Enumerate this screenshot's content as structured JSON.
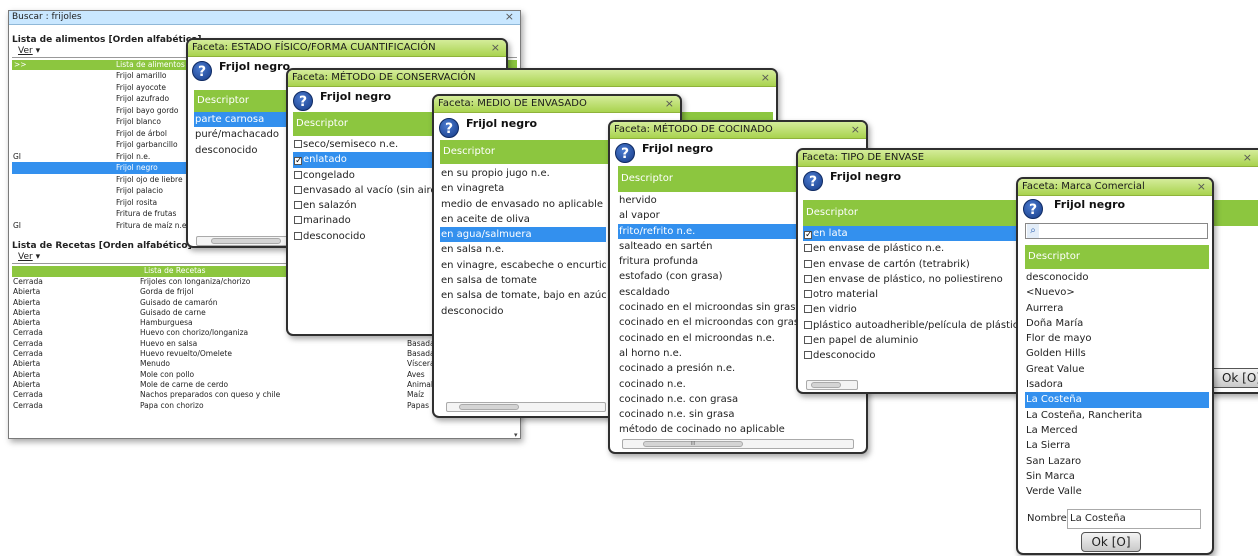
{
  "search_window": {
    "title": "Buscar : frijoles",
    "foods_title": "Lista de alimentos [Orden alfabético]",
    "recipes_title": "Lista de Recetas [Orden alfabético]",
    "ver_label": "Ver",
    "foods_header_left": ">>",
    "foods_header": "Lista de alimentos",
    "foods": [
      {
        "code": "",
        "name": "Frijol amarillo"
      },
      {
        "code": "",
        "name": "Frijol ayocote"
      },
      {
        "code": "",
        "name": "Frijol azufrado"
      },
      {
        "code": "",
        "name": "Frijol bayo gordo"
      },
      {
        "code": "",
        "name": "Frijol blanco"
      },
      {
        "code": "",
        "name": "Frijol de árbol"
      },
      {
        "code": "",
        "name": "Frijol garbancillo"
      },
      {
        "code": "GI",
        "name": "Frijol n.e."
      },
      {
        "code": "",
        "name": "Frijol negro"
      },
      {
        "code": "",
        "name": "Frijol ojo de liebre"
      },
      {
        "code": "",
        "name": "Frijol palacio"
      },
      {
        "code": "",
        "name": "Frijol rosita"
      },
      {
        "code": "",
        "name": "Fritura de frutas"
      },
      {
        "code": "GI",
        "name": "Fritura de maíz n.e."
      }
    ],
    "recipes_header": "Lista de Recetas",
    "recipes": [
      {
        "status": "Cerrada",
        "name": "Frijoles con longaniza/chorizo",
        "cat": ""
      },
      {
        "status": "Abierta",
        "name": "Gorda de frijol",
        "cat": ""
      },
      {
        "status": "Abierta",
        "name": "Guisado de camarón",
        "cat": ""
      },
      {
        "status": "Abierta",
        "name": "Guisado de carne",
        "cat": ""
      },
      {
        "status": "Abierta",
        "name": "Hamburguesa",
        "cat": ""
      },
      {
        "status": "Cerrada",
        "name": "Huevo con chorizo/longaniza",
        "cat": "Basada"
      },
      {
        "status": "Cerrada",
        "name": "Huevo en salsa",
        "cat": "Basada"
      },
      {
        "status": "Cerrada",
        "name": "Huevo revuelto/Omelete",
        "cat": "Basada"
      },
      {
        "status": "Abierta",
        "name": "Menudo",
        "cat": "Vísceras"
      },
      {
        "status": "Abierta",
        "name": "Mole con pollo",
        "cat": "Aves"
      },
      {
        "status": "Abierta",
        "name": "Mole de carne de cerdo",
        "cat": "Animal"
      },
      {
        "status": "Cerrada",
        "name": "Nachos preparados con queso y chile",
        "cat": "Maíz"
      },
      {
        "status": "Cerrada",
        "name": "Papa con chorizo",
        "cat": "Papas"
      }
    ]
  },
  "facet1": {
    "title": "Faceta: ESTADO FÍSICO/FORMA CUANTIFICACIÓN",
    "food": "Frijol negro",
    "header": "Descriptor",
    "items": [
      "parte carnosa",
      "puré/machacado",
      "desconocido"
    ],
    "selected": 0
  },
  "facet2": {
    "title": "Faceta: MÉTODO DE CONSERVACIÓN",
    "food": "Frijol negro",
    "header": "Descriptor",
    "items": [
      "seco/semiseco n.e.",
      "enlatado",
      "congelado",
      "envasado al vacío (sin aire)",
      "en salazón",
      "marinado",
      "desconocido"
    ],
    "selected": 1
  },
  "facet3": {
    "title": "Faceta: MEDIO DE ENVASADO",
    "food": "Frijol negro",
    "header": "Descriptor",
    "items": [
      "en su propio jugo n.e.",
      "en vinagreta",
      "medio de envasado no aplicable",
      "en aceite de oliva",
      "en agua/salmuera",
      "en salsa n.e.",
      "en vinagre, escabeche o encurtido",
      "en salsa de tomate",
      "en salsa de tomate, bajo en azúcar",
      "desconocido"
    ],
    "selected": 4
  },
  "facet4": {
    "title": "Faceta: MÉTODO DE COCINADO",
    "food": "Frijol negro",
    "header": "Descriptor",
    "items": [
      "hervido",
      "al vapor",
      "frito/refrito n.e.",
      "salteado en sartén",
      "fritura profunda",
      "estofado (con grasa)",
      "escaldado",
      "cocinado en el microondas sin grasa",
      "cocinado en el microondas con grasa",
      "cocinado en el microondas n.e.",
      "al horno n.e.",
      "cocinado a presión n.e.",
      "cocinado n.e.",
      "cocinado n.e. con grasa",
      "cocinado n.e. sin grasa",
      "método de cocinado no aplicable"
    ],
    "selected": 2,
    "scroll_label": "III"
  },
  "facet5": {
    "title": "Faceta: TIPO DE ENVASE",
    "food": "Frijol negro",
    "header": "Descriptor",
    "items": [
      "en lata",
      "en envase de plástico n.e.",
      "en envase de cartón (tetrabrik)",
      "en envase de plástico, no poliestireno",
      "otro material",
      "en vidrio",
      "plástico autoadherible/película de plástico",
      "en papel de aluminio",
      "desconocido"
    ],
    "selected": 0
  },
  "facet6": {
    "title": "Faceta: Marca Comercial",
    "food": "Frijol negro",
    "header": "Descriptor",
    "items": [
      "desconocido",
      "<Nuevo>",
      "Aurrera",
      "Doña María",
      "Flor de mayo",
      "Golden Hills",
      "Great Value",
      "Isadora",
      "La Costeña",
      "La Costeña, Rancherita",
      "La Merced",
      "La Sierra",
      "San Lazaro",
      "Sin Marca",
      "Verde Valle"
    ],
    "selected": 8,
    "name_label": "Nombre",
    "name_value": "La Costeña",
    "ok_label": "Ok [O]",
    "behind_ok_label": "Ok [O]"
  },
  "colors": {
    "green": "#8cc63f",
    "selection": "#3390ee",
    "title_green": "#a9d34f"
  }
}
